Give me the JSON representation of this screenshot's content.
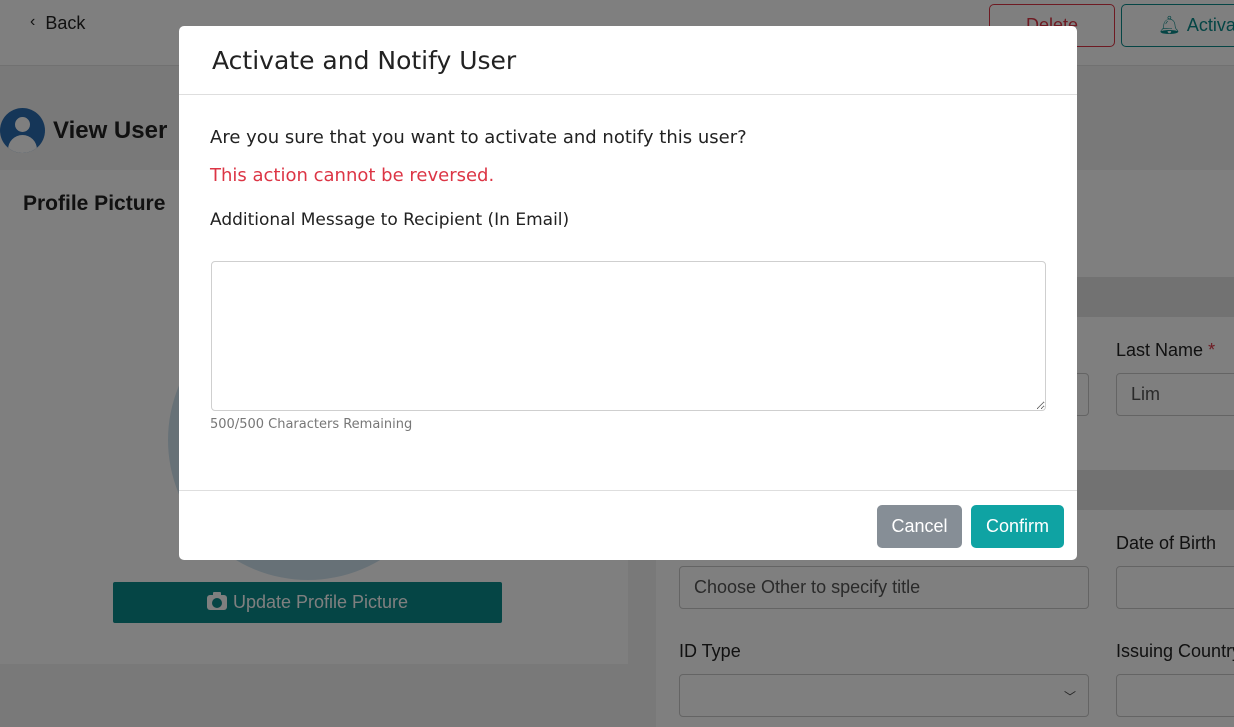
{
  "topbar": {
    "back_label": "Back",
    "delete_label": "Delete",
    "activate_label": "Activate"
  },
  "page": {
    "title": "View User"
  },
  "profile": {
    "title": "Profile Picture",
    "update_button": "Update Profile Picture"
  },
  "form": {
    "last_name_label": "Last Name",
    "required_marker": "*",
    "last_name_value": "Lim",
    "date_of_birth_label": "Date of Birth",
    "title_placeholder": "Choose Other to specify title",
    "id_type_label": "ID Type",
    "issuing_country_label": "Issuing Country"
  },
  "modal": {
    "title": "Activate and Notify User",
    "question": "Are you sure that you want to activate and notify this user?",
    "warning": "This action cannot be reversed.",
    "message_label": "Additional Message to Recipient (In Email)",
    "message_value": "",
    "char_count": "500/500 Characters Remaining",
    "cancel_label": "Cancel",
    "confirm_label": "Confirm"
  },
  "colors": {
    "accent": "#0fa3a3",
    "danger": "#dc3545",
    "secondary": "#868e96"
  }
}
